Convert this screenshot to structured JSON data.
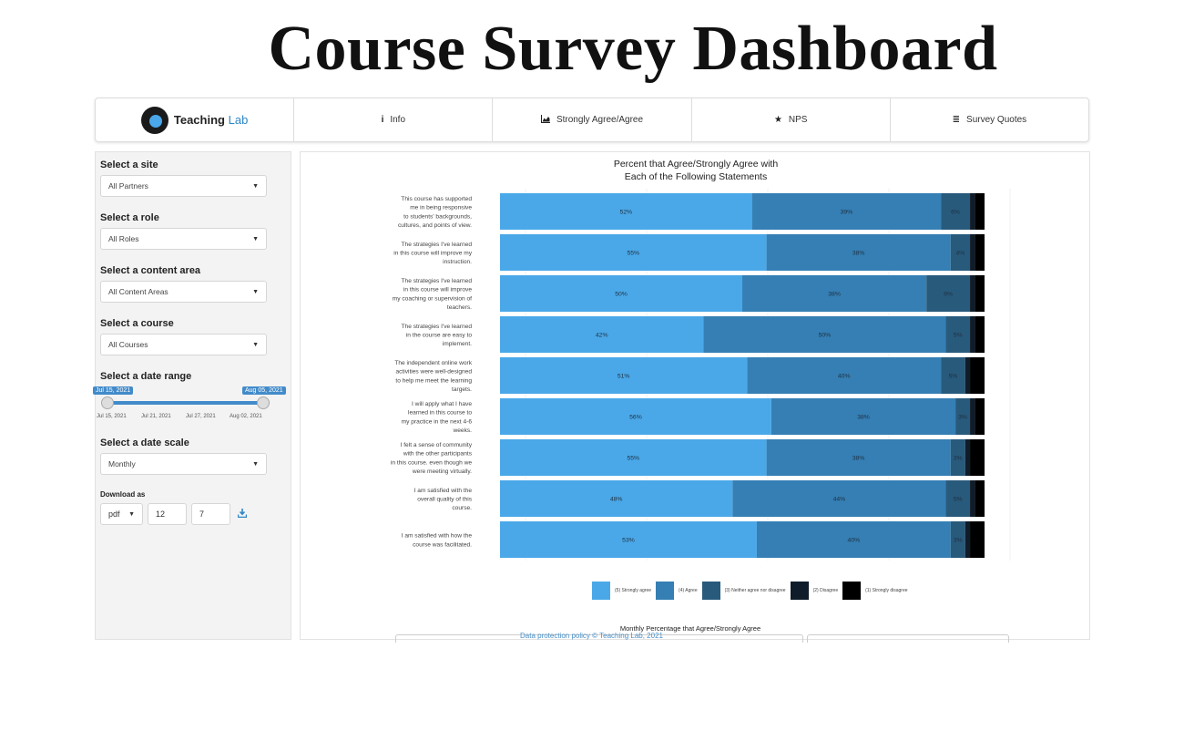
{
  "page_title": "Course Survey Dashboard",
  "navbar": {
    "logo_text_a": "Teaching",
    "logo_text_b": "Lab",
    "tabs": [
      {
        "label": "Info",
        "icon": "info-icon"
      },
      {
        "label": "Strongly Agree/Agree",
        "icon": "area-chart-icon"
      },
      {
        "label": "NPS",
        "icon": "star-icon"
      },
      {
        "label": "Survey Quotes",
        "icon": "list-icon"
      }
    ]
  },
  "sidebar": {
    "site": {
      "label": "Select a site",
      "value": "All Partners"
    },
    "role": {
      "label": "Select a role",
      "value": "All Roles"
    },
    "content": {
      "label": "Select a content area",
      "value": "All Content Areas"
    },
    "course": {
      "label": "Select a course",
      "value": "All Courses"
    },
    "date_range": {
      "label": "Select a date range",
      "start": "Jul 15, 2021",
      "end": "Aug 05, 2021",
      "ticks": [
        "Jul 15, 2021",
        "Jul 21, 2021",
        "Jul 27, 2021",
        "Aug 02, 2021"
      ]
    },
    "date_scale": {
      "label": "Select a date scale",
      "value": "Monthly"
    },
    "download": {
      "label": "Download as",
      "format": "pdf",
      "width": "12",
      "height": "7",
      "icon": "download-icon"
    }
  },
  "chart_data": {
    "type": "bar",
    "orientation": "horizontal-stacked",
    "title_line1": "Percent that Agree/Strongly Agree with",
    "title_line2": "Each of the Following Statements",
    "categories": [
      "This course has supported me in being responsive to students' backgrounds, cultures, and points of view.",
      "The strategies I've learned in this course will improve my instruction.",
      "The strategies I've learned in this course will improve my coaching or supervision of teachers.",
      "The strategies I've learned in the course are easy to implement.",
      "The independent online work activities were well-designed to help me meet the learning targets.",
      "I will apply what I have learned in this course to my practice in the next 4-6 weeks.",
      "I felt a sense of community with the other participants in this course. even though we were meeting virtually.",
      "I am satisfied with the overall quality of this course.",
      "I am satisfied with how the course was facilitated."
    ],
    "category_lines": [
      [
        "This course has supported",
        "me in being responsive",
        "to students' backgrounds,",
        "cultures, and points of view."
      ],
      [
        "The strategies I've learned",
        "in this course will improve my",
        "instruction."
      ],
      [
        "The strategies I've learned",
        "in this course will improve",
        "my coaching or supervision of",
        "teachers."
      ],
      [
        "The strategies I've learned",
        "in the course are easy to",
        "implement."
      ],
      [
        "The independent online work",
        "activities were well-designed",
        "to help me meet the learning",
        "targets."
      ],
      [
        "I will apply what I have",
        "learned in this course to",
        "my practice in the next 4-6",
        "weeks."
      ],
      [
        "I felt a sense of community",
        "with the other participants",
        "in this course. even though we",
        "were meeting virtually."
      ],
      [
        "I am satisfied with the",
        "overall quality of this",
        "course."
      ],
      [
        "I am satisfied with how the",
        "course was facilitated."
      ]
    ],
    "series": [
      {
        "name": "(5) Strongly agree",
        "color": "#4aa8e8",
        "values": [
          52,
          55,
          50,
          42,
          51,
          56,
          55,
          48,
          53
        ],
        "labels": [
          "52%",
          "55%",
          "50%",
          "42%",
          "51%",
          "56%",
          "55%",
          "48%",
          "53%"
        ]
      },
      {
        "name": "(4) Agree",
        "color": "#357fb4",
        "values": [
          39,
          38,
          38,
          50,
          40,
          38,
          38,
          44,
          40
        ],
        "labels": [
          "39%",
          "38%",
          "38%",
          "50%",
          "40%",
          "38%",
          "38%",
          "44%",
          "40%"
        ]
      },
      {
        "name": "(3) Neither agree nor disagree",
        "color": "#285a7c",
        "values": [
          6,
          4,
          9,
          5,
          5,
          3,
          3,
          5,
          3
        ],
        "labels": [
          "6%",
          "4%",
          "9%",
          "5%",
          "5%",
          "3%",
          "3%",
          "5%",
          "3%"
        ]
      },
      {
        "name": "(2) Disagree",
        "color": "#0f1c2a",
        "values": [
          1,
          1,
          1,
          1,
          1,
          1,
          1,
          1,
          1
        ],
        "labels": [
          "",
          "",
          "",
          "",
          "",
          "",
          "",
          "",
          ""
        ]
      },
      {
        "name": "(1) Strongly disagree",
        "color": "#000000",
        "values": [
          2,
          2,
          2,
          2,
          3,
          2,
          3,
          2,
          3
        ],
        "labels": [
          "",
          "",
          "",
          "",
          "",
          "",
          "",
          "",
          ""
        ]
      }
    ],
    "xlim": [
      0,
      100
    ],
    "legend_position": "bottom"
  },
  "secondary_chart": {
    "title": "Monthly Percentage that Agree/Strongly Agree"
  },
  "footer": {
    "text": "Data protection policy  © Teaching Lab, 2021"
  }
}
